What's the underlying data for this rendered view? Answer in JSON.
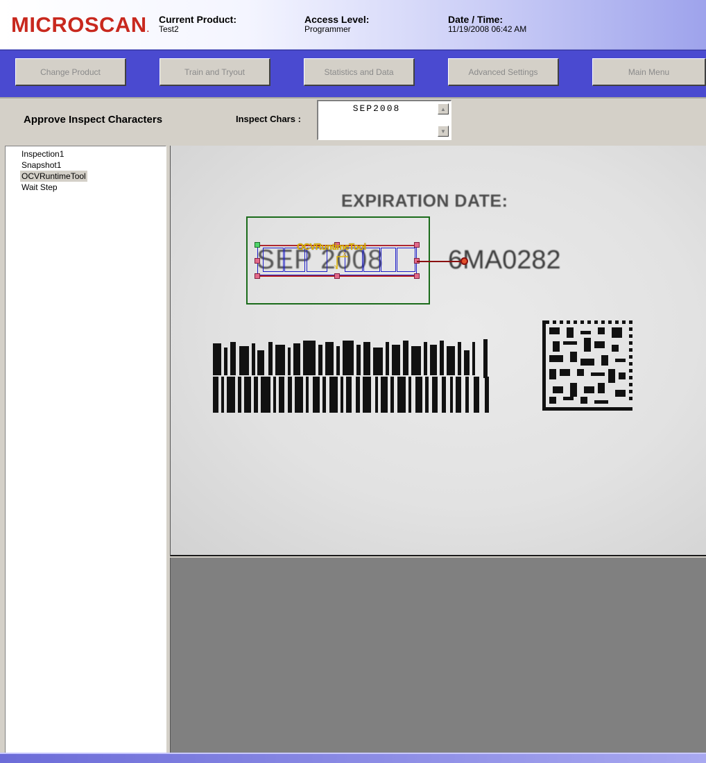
{
  "header": {
    "logo": "MICROSCAN",
    "current_product_label": "Current Product:",
    "current_product_value": "Test2",
    "access_level_label": "Access Level:",
    "access_level_value": "Programmer",
    "datetime_label": "Date / Time:",
    "datetime_value": "11/19/2008 06:42 AM"
  },
  "toolbar": {
    "buttons": [
      {
        "label": "Change Product"
      },
      {
        "label": "Train and Tryout"
      },
      {
        "label": "Statistics and Data"
      },
      {
        "label": "Advanced Settings"
      },
      {
        "label": "Main Menu"
      }
    ]
  },
  "subbar": {
    "title": "Approve Inspect Characters",
    "inspect_chars_label": "Inspect Chars :",
    "inspect_chars_value": "SEP2008"
  },
  "tree": {
    "items": [
      {
        "label": "Inspection1",
        "selected": false
      },
      {
        "label": "Snapshot1",
        "selected": false
      },
      {
        "label": "OCVRuntimeTool",
        "selected": true
      },
      {
        "label": "Wait Step",
        "selected": false
      }
    ]
  },
  "image": {
    "heading_text": "EXPIRATION DATE:",
    "lot_text": "6MA0282",
    "date_text": "SEP 2008",
    "tool_label": "OCVRuntimeTool"
  },
  "colors": {
    "brand_red": "#c8281e",
    "toolbar_blue": "#4a4ad0",
    "roi_green": "#1a6b1a",
    "tool_blue": "#1c1cc8",
    "tool_label_yellow": "#e0b400"
  }
}
